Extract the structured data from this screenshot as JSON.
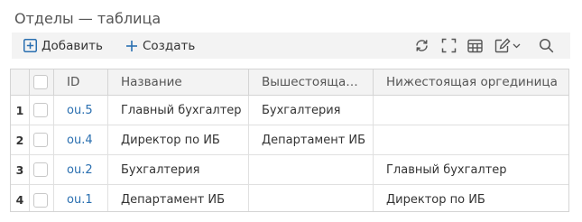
{
  "title": "Отделы — таблица",
  "toolbar": {
    "add_label": "Добавить",
    "create_label": "Создать",
    "icons": [
      "add-square-icon",
      "plus-icon",
      "refresh-icon",
      "fullscreen-icon",
      "table-icon",
      "edit-icon",
      "chevron-down-icon",
      "search-icon"
    ]
  },
  "table": {
    "columns": {
      "id": "ID",
      "name": "Название",
      "parent": "Вышестояща…",
      "child": "Нижестоящая оргединица"
    },
    "rows": [
      {
        "num": "1",
        "id": "ou.5",
        "name": "Главный бухгалтер",
        "parent": "Бухгалтерия",
        "child": ""
      },
      {
        "num": "2",
        "id": "ou.4",
        "name": "Директор по ИБ",
        "parent": "Департамент ИБ",
        "child": ""
      },
      {
        "num": "3",
        "id": "ou.2",
        "name": "Бухгалтерия",
        "parent": "",
        "child": "Главный бухгалтер"
      },
      {
        "num": "4",
        "id": "ou.1",
        "name": "Департамент ИБ",
        "parent": "",
        "child": "Директор по ИБ"
      }
    ]
  },
  "colors": {
    "link": "#2a6fb0",
    "toolbar_bg": "#f3f3f3",
    "icon_blue": "#2a6fb0"
  }
}
